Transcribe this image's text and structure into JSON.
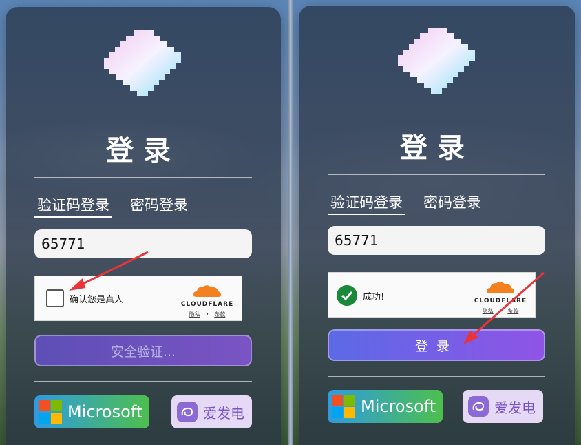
{
  "left_panel": {
    "title": "登录",
    "tabs": [
      "验证码登录",
      "密码登录"
    ],
    "code_value": "65771",
    "captcha": {
      "label": "确认您是真人",
      "brand": "CLOUDFLARE",
      "link_privacy": "隐私",
      "link_sep": "•",
      "link_terms": "条款"
    },
    "main_button": "安全验证...",
    "microsoft_label": "Microsoft",
    "afdian_label": "爱发电"
  },
  "right_panel": {
    "title": "登录",
    "tabs": [
      "验证码登录",
      "密码登录"
    ],
    "code_value": "65771",
    "captcha": {
      "label": "成功!",
      "brand": "CLOUDFLARE",
      "link_privacy": "隐私",
      "link_sep": "•",
      "link_terms": "条款"
    },
    "main_button": "登录",
    "microsoft_label": "Microsoft",
    "afdian_label": "爱发电"
  },
  "colors": {
    "card_bg": "#263042",
    "verify_button": "#5d4fb5",
    "login_button": "#7a54e6",
    "success_green": "#1a8a3a",
    "cloudflare_orange": "#f48120",
    "annotation_arrow": "#e8343a"
  },
  "icons": [
    "pixel-diamond-logo",
    "cloudflare-cloud-icon",
    "microsoft-logo-icon",
    "afdian-icon",
    "check-circle-icon",
    "red-arrow-annotation"
  ]
}
